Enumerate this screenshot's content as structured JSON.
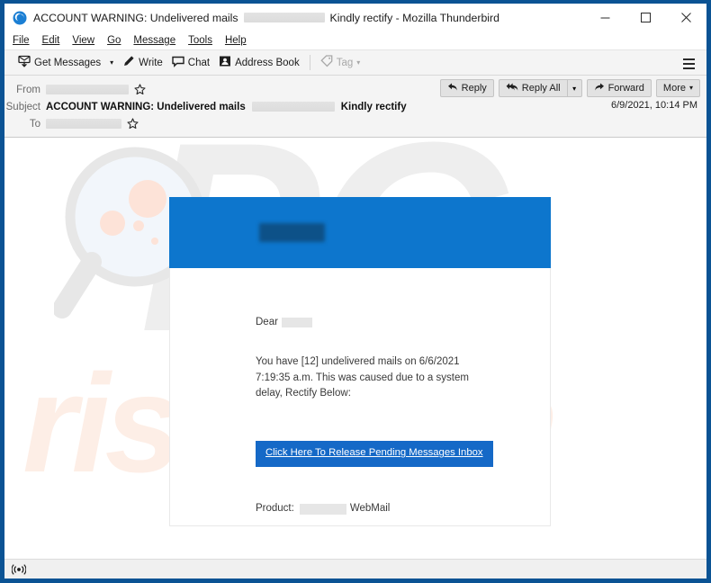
{
  "window": {
    "title_prefix": "ACCOUNT WARNING: Undelivered mails",
    "title_suffix": "Kindly rectify - Mozilla Thunderbird",
    "app_icon": "thunderbird-icon",
    "minimize_label": "—",
    "maximize_label": "☐",
    "close_label": "×",
    "frame_color": "#0b5394"
  },
  "menubar": {
    "items": [
      {
        "label": "File"
      },
      {
        "label": "Edit"
      },
      {
        "label": "View"
      },
      {
        "label": "Go"
      },
      {
        "label": "Message"
      },
      {
        "label": "Tools"
      },
      {
        "label": "Help"
      }
    ]
  },
  "toolbar": {
    "get_messages_label": "Get Messages",
    "get_messages_icon": "download-mail-icon",
    "get_messages_caret": "▾",
    "write_label": "Write",
    "write_icon": "pencil-icon",
    "chat_label": "Chat",
    "chat_icon": "speech-bubble-icon",
    "address_book_label": "Address Book",
    "address_book_icon": "contact-card-icon",
    "tag_label": "Tag",
    "tag_icon": "tag-icon",
    "tag_caret": "▾",
    "app_menu_icon": "hamburger-icon"
  },
  "message_header": {
    "from_label": "From",
    "from_value_redacted": true,
    "from_star_icon": "star-icon",
    "subject_label": "Subject",
    "subject_prefix": "ACCOUNT WARNING: Undelivered mails",
    "subject_suffix": "Kindly rectify",
    "to_label": "To",
    "to_value_redacted": true,
    "to_star_icon": "star-icon",
    "date": "6/9/2021, 10:14 PM",
    "actions": {
      "reply_label": "Reply",
      "reply_icon": "reply-arrow-icon",
      "reply_all_label": "Reply All",
      "reply_all_icon": "reply-all-arrow-icon",
      "reply_all_caret": "▾",
      "forward_label": "Forward",
      "forward_icon": "forward-arrow-icon",
      "more_label": "More",
      "more_caret": "▾"
    }
  },
  "email": {
    "banner_color": "#0d76cd",
    "banner_logo_redacted": true,
    "greeting": "Dear",
    "greeting_name_redacted": true,
    "body_line_1": "You have [12] undelivered mails on 6/6/2021",
    "body_line_2": "7:19:35 a.m. This was caused due to a system",
    "body_line_3": "delay, Rectify Below:",
    "cta_label": "Click Here To Release Pending Messages Inbox",
    "cta_color": "#1569c7",
    "product_label": "Product:",
    "product_name_redacted": true,
    "product_suffix": "WebMail"
  },
  "watermark": {
    "logo_text": "PC",
    "domain_text": "risk.com",
    "glass_icon": "magnifier-icon",
    "logo_color": "#eeeeee",
    "domain_color": "#fdeee6"
  },
  "statusbar": {
    "connection_icon": "signal-icon"
  }
}
